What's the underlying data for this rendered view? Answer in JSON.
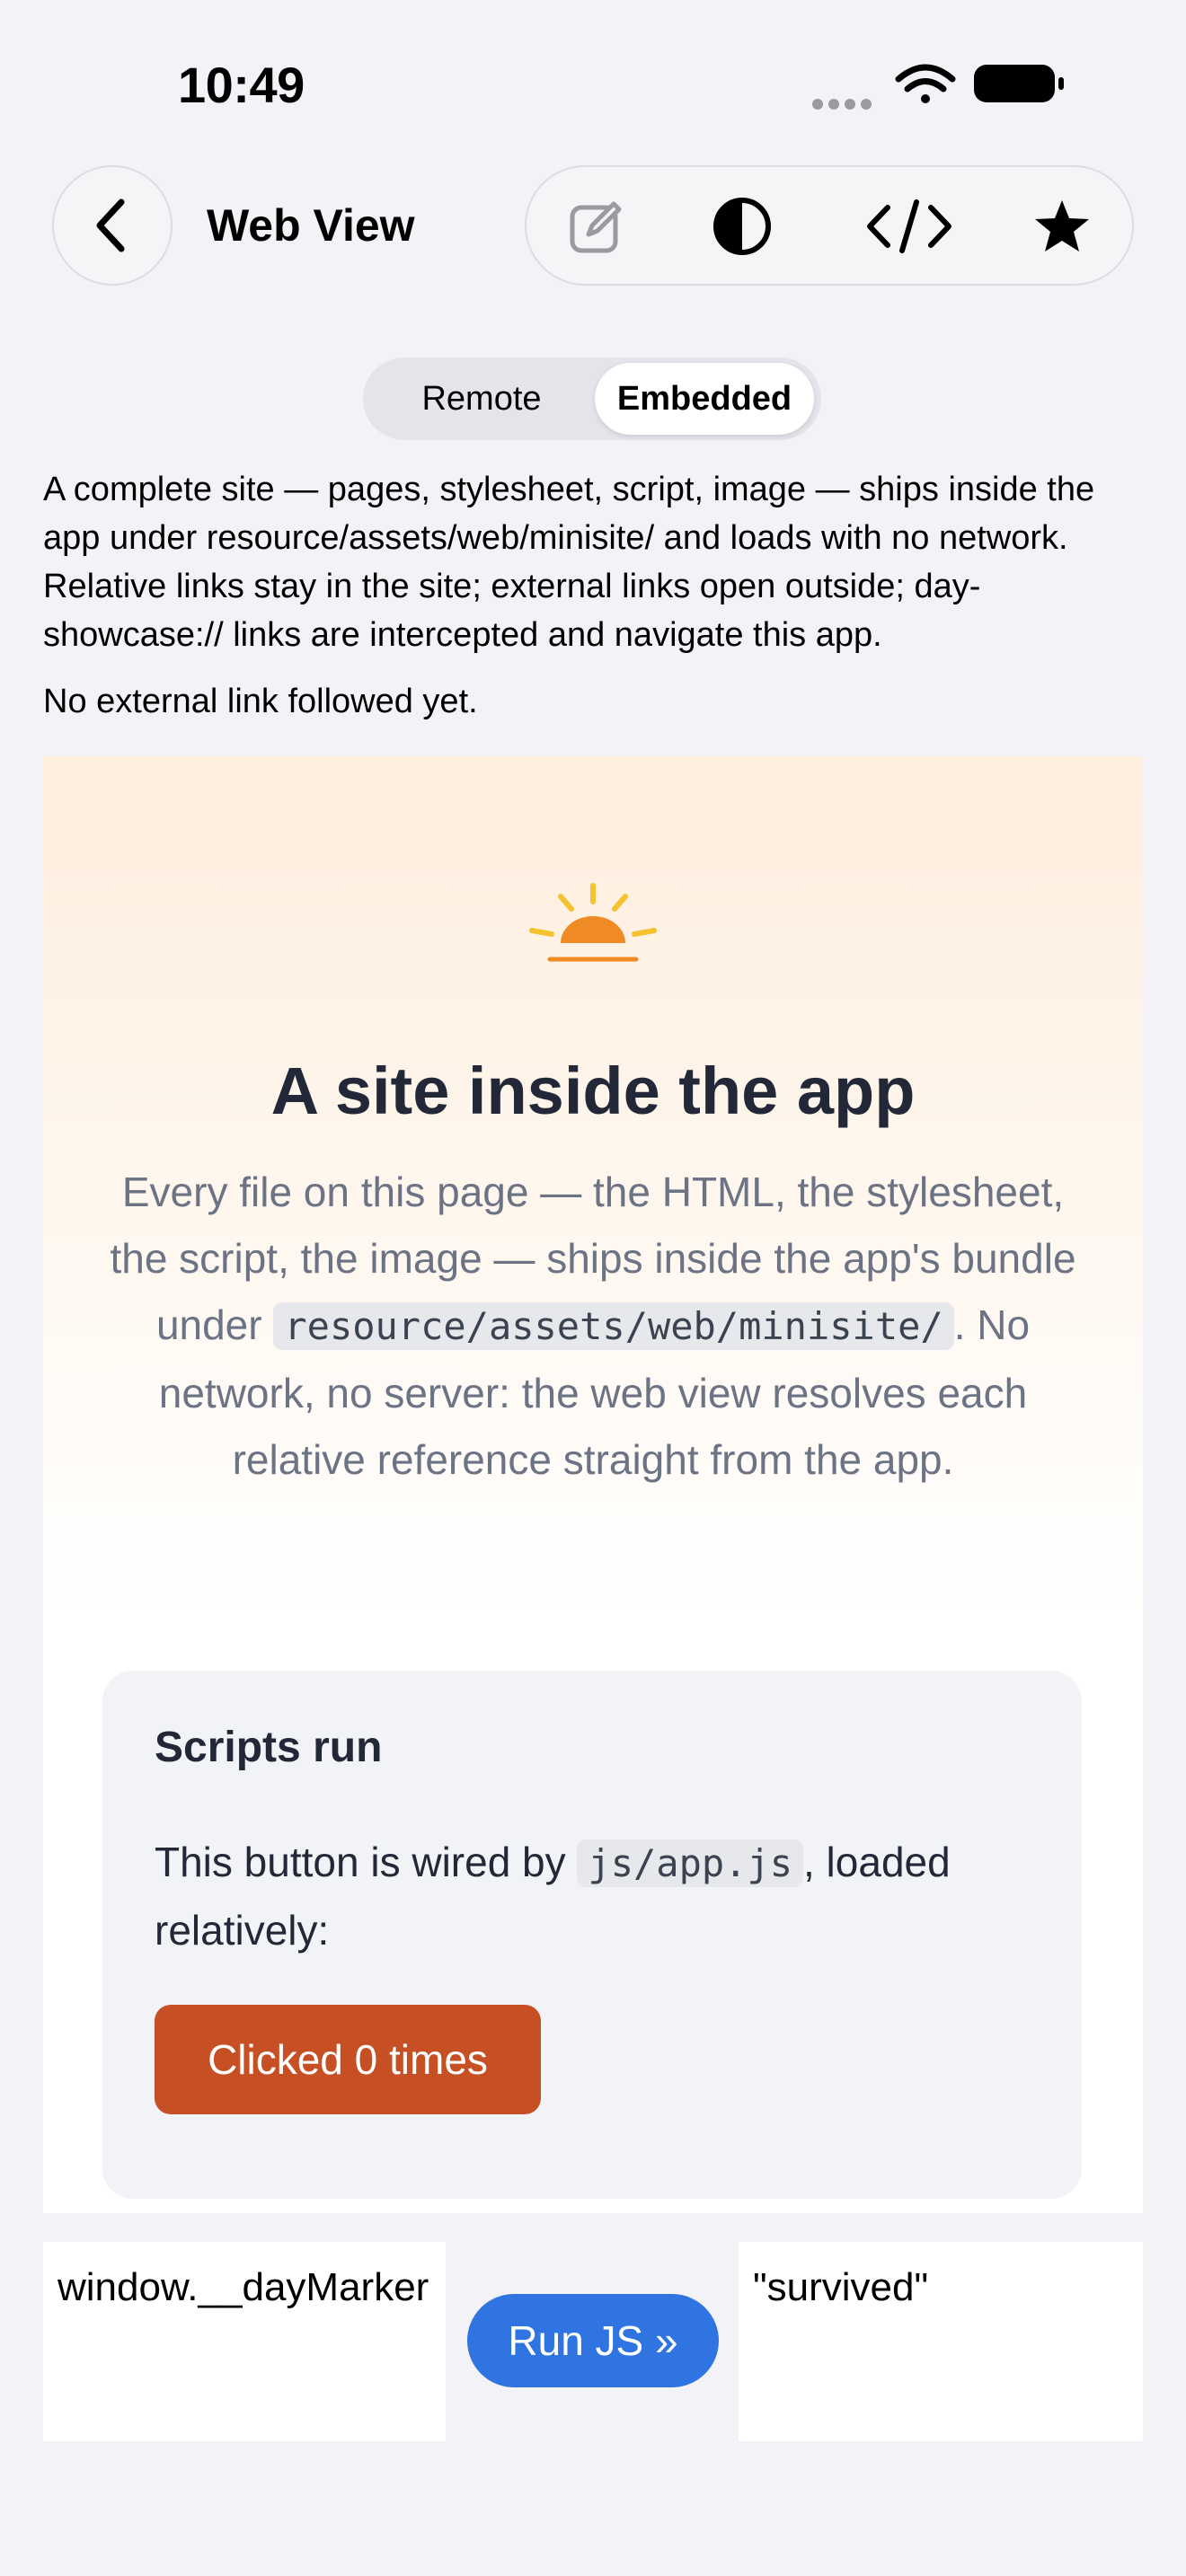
{
  "status_bar": {
    "time": "10:49",
    "icons": [
      "signal-dots-icon",
      "wifi-icon",
      "battery-icon"
    ]
  },
  "nav": {
    "title": "Web View",
    "back_icon": "chevron-left-icon",
    "toolbar_icons": [
      "edit-icon",
      "contrast-icon",
      "code-icon",
      "star-icon"
    ]
  },
  "segmented": {
    "options": [
      "Remote",
      "Embedded"
    ],
    "selected": "Embedded"
  },
  "description": "A complete site — pages, stylesheet, script, image — ships inside the app under resource/assets/web/minisite/ and loads with no network. Relative links stay in the site; external links open outside; day-showcase:// links are intercepted and navigate this app.",
  "status_text": "No external link followed yet.",
  "web": {
    "hero_icon": "sunrise-icon",
    "title": "A site inside the app",
    "desc_before": "Every file on this page — the HTML, the stylesheet, the script, the image — ships inside the app's bundle under ",
    "desc_code": "resource/assets/web/minisite/",
    "desc_after": ". No network, no server: the web view resolves each relative reference straight from the app.",
    "card": {
      "title": "Scripts run",
      "text_before": "This button is wired by ",
      "text_code": "js/app.js",
      "text_after": ", loaded relatively:",
      "button_label": "Clicked 0 times"
    }
  },
  "js_panel": {
    "expression": "window.__dayMarker",
    "run_label": "Run JS »",
    "result": "\"survived\""
  },
  "colors": {
    "accent_blue": "#2f74e0",
    "button_orange": "#c64f24",
    "sun_yellow": "#f5c232",
    "sun_orange": "#f08a24"
  }
}
